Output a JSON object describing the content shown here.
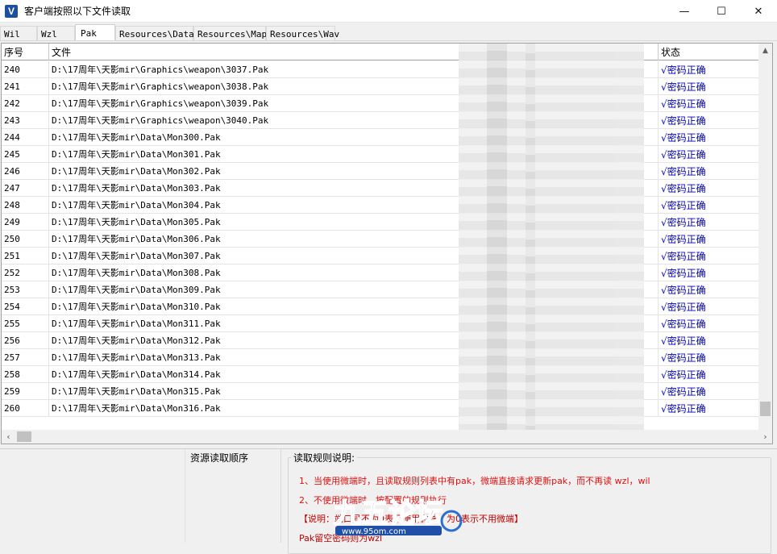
{
  "window": {
    "title": "客户端按照以下文件读取",
    "icon_letter": "V"
  },
  "controls": {
    "minimize": "—",
    "maximize": "☐",
    "close": "✕"
  },
  "tabs": [
    {
      "label": "Wil"
    },
    {
      "label": "Wzl"
    },
    {
      "label": "Pak"
    },
    {
      "label": "Resources\\Data"
    },
    {
      "label": "Resources\\Map"
    },
    {
      "label": "Resources\\Wav"
    }
  ],
  "grid": {
    "headers": {
      "no": "序号",
      "file": "文件",
      "status": "状态"
    },
    "rows": [
      {
        "no": "240",
        "file": "D:\\17周年\\天影mir\\Graphics\\weapon\\3037.Pak",
        "status": "√密码正确"
      },
      {
        "no": "241",
        "file": "D:\\17周年\\天影mir\\Graphics\\weapon\\3038.Pak",
        "status": "√密码正确"
      },
      {
        "no": "242",
        "file": "D:\\17周年\\天影mir\\Graphics\\weapon\\3039.Pak",
        "status": "√密码正确"
      },
      {
        "no": "243",
        "file": "D:\\17周年\\天影mir\\Graphics\\weapon\\3040.Pak",
        "status": "√密码正确"
      },
      {
        "no": "244",
        "file": "D:\\17周年\\天影mir\\Data\\Mon300.Pak",
        "status": "√密码正确"
      },
      {
        "no": "245",
        "file": "D:\\17周年\\天影mir\\Data\\Mon301.Pak",
        "status": "√密码正确"
      },
      {
        "no": "246",
        "file": "D:\\17周年\\天影mir\\Data\\Mon302.Pak",
        "status": "√密码正确"
      },
      {
        "no": "247",
        "file": "D:\\17周年\\天影mir\\Data\\Mon303.Pak",
        "status": "√密码正确"
      },
      {
        "no": "248",
        "file": "D:\\17周年\\天影mir\\Data\\Mon304.Pak",
        "status": "√密码正确"
      },
      {
        "no": "249",
        "file": "D:\\17周年\\天影mir\\Data\\Mon305.Pak",
        "status": "√密码正确"
      },
      {
        "no": "250",
        "file": "D:\\17周年\\天影mir\\Data\\Mon306.Pak",
        "status": "√密码正确"
      },
      {
        "no": "251",
        "file": "D:\\17周年\\天影mir\\Data\\Mon307.Pak",
        "status": "√密码正确"
      },
      {
        "no": "252",
        "file": "D:\\17周年\\天影mir\\Data\\Mon308.Pak",
        "status": "√密码正确"
      },
      {
        "no": "253",
        "file": "D:\\17周年\\天影mir\\Data\\Mon309.Pak",
        "status": "√密码正确"
      },
      {
        "no": "254",
        "file": "D:\\17周年\\天影mir\\Data\\Mon310.Pak",
        "status": "√密码正确"
      },
      {
        "no": "255",
        "file": "D:\\17周年\\天影mir\\Data\\Mon311.Pak",
        "status": "√密码正确"
      },
      {
        "no": "256",
        "file": "D:\\17周年\\天影mir\\Data\\Mon312.Pak",
        "status": "√密码正确"
      },
      {
        "no": "257",
        "file": "D:\\17周年\\天影mir\\Data\\Mon313.Pak",
        "status": "√密码正确"
      },
      {
        "no": "258",
        "file": "D:\\17周年\\天影mir\\Data\\Mon314.Pak",
        "status": "√密码正确"
      },
      {
        "no": "259",
        "file": "D:\\17周年\\天影mir\\Data\\Mon315.Pak",
        "status": "√密码正确"
      },
      {
        "no": "260",
        "file": "D:\\17周年\\天影mir\\Data\\Mon316.Pak",
        "status": "√密码正确"
      }
    ]
  },
  "panels": {
    "order_title": "资源读取顺序",
    "rules_title": "读取规则说明:",
    "rules": [
      "1、当使用微端时，且读取规则列表中有pak，微端直接请求更新pak，而不再读 wzl，wil",
      "2、不使用微端时，按配置的规则执行",
      "【说明：端口号不为0表示使用微端，为0表示不用微端】",
      "Pak留空密码则为wzl"
    ]
  },
  "colors": {
    "status": "#0000c0",
    "rules": "#e01010",
    "brand": "#1c4f9c"
  },
  "watermark": {
    "text": "九五论坛",
    "url": "www.95om.com"
  }
}
